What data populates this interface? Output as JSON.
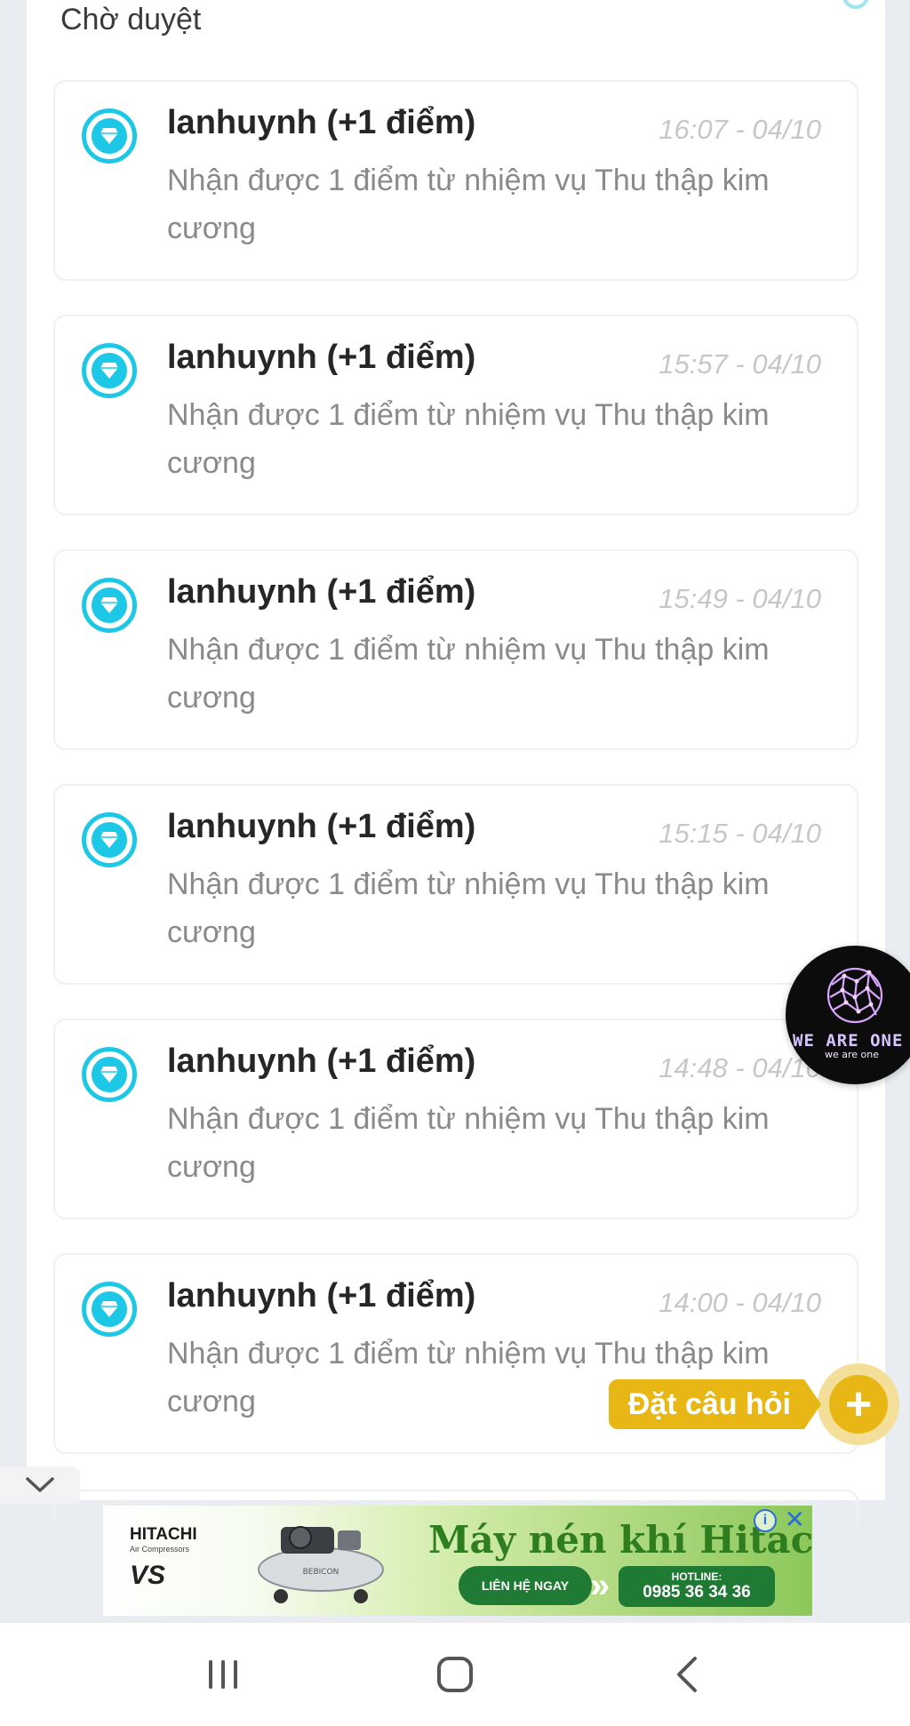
{
  "section": {
    "title": "Chờ duyệt"
  },
  "notifications": [
    {
      "user": "lanhuynh (+1 điểm)",
      "time": "16:07 - 04/10",
      "message": "Nhận được 1 điểm từ nhiệm vụ Thu thập kim cương",
      "icon": "diamond-icon"
    },
    {
      "user": "lanhuynh (+1 điểm)",
      "time": "15:57 - 04/10",
      "message": "Nhận được 1 điểm từ nhiệm vụ Thu thập kim cương",
      "icon": "diamond-icon"
    },
    {
      "user": "lanhuynh (+1 điểm)",
      "time": "15:49 - 04/10",
      "message": "Nhận được 1 điểm từ nhiệm vụ Thu thập kim cương",
      "icon": "diamond-icon"
    },
    {
      "user": "lanhuynh (+1 điểm)",
      "time": "15:15 - 04/10",
      "message": "Nhận được 1 điểm từ nhiệm vụ Thu thập kim cương",
      "icon": "diamond-icon"
    },
    {
      "user": "lanhuynh (+1 điểm)",
      "time": "14:48 - 04/10",
      "message": "Nhận được 1 điểm từ nhiệm vụ Thu thập kim cương",
      "icon": "diamond-icon"
    },
    {
      "user": "lanhuynh (+1 điểm)",
      "time": "14:00 - 04/10",
      "message": "Nhận được 1 điểm từ nhiệm vụ Thu thập kim cương",
      "icon": "diamond-icon"
    }
  ],
  "ask_button": {
    "label": "Đặt câu hỏi",
    "icon": "plus-icon"
  },
  "floating_avatar": {
    "text": "WE ARE ONE",
    "subtext": "we are one"
  },
  "ad": {
    "brand": "HITACHI",
    "brand_sub": "Air Compressors",
    "series": "VS",
    "headline": "Máy nén khí Hitachi",
    "cta": "LIÊN HỆ NGAY",
    "hotline_label": "HOTLINE:",
    "hotline_number": "0985 36 34 36",
    "product_label": "BEBICON"
  },
  "colors": {
    "accent": "#1cc8e6",
    "ask_yellow": "#e9b715",
    "ad_green": "#1f7a34"
  },
  "navbar": {
    "recents": "recents-icon",
    "home": "home-icon",
    "back": "back-icon"
  }
}
